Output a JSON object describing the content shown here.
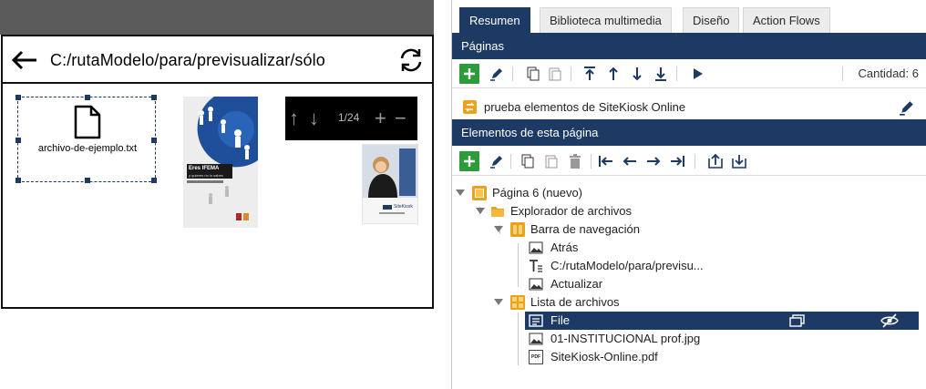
{
  "preview": {
    "nav": {
      "path": "C:/rutaModelo/para/previsualizar/sólo"
    },
    "file_item": {
      "name": "archivo-de-ejemplo.txt"
    },
    "thumbs": {
      "ifema": {
        "heading": "Eres IFEMA",
        "subheading": "y quieres no lo sabes"
      },
      "controls": {
        "page_count": "1/24"
      },
      "sitekiosk": {
        "brand": "SiteKiosk"
      }
    }
  },
  "panel": {
    "tabs": [
      {
        "label": "Resumen"
      },
      {
        "label": "Biblioteca multimedia"
      },
      {
        "label": "Diseño"
      },
      {
        "label": "Action Flows"
      }
    ],
    "pages_section": {
      "title": "Páginas",
      "count_label": "Cantidad: 6"
    },
    "page_row": {
      "label": "prueba elementos de SiteKiosk Online"
    },
    "elements_section": {
      "title": "Elementos de esta página"
    },
    "tree": {
      "root": "Página 6 (nuevo)",
      "explorer": "Explorador de archivos",
      "nav_bar": "Barra de navegación",
      "back": "Atrás",
      "path": "C:/rutaModelo/para/previsu...",
      "refresh": "Actualizar",
      "file_list": "Lista de archivos",
      "file": "File",
      "jpg": "01-INSTITUCIONAL prof.jpg",
      "pdf": "SiteKiosk-Online.pdf",
      "pdf_badge": "PDF"
    }
  },
  "colors": {
    "navy": "#1c3a64",
    "green": "#2e9b3a",
    "folder": "#e8a21b"
  }
}
